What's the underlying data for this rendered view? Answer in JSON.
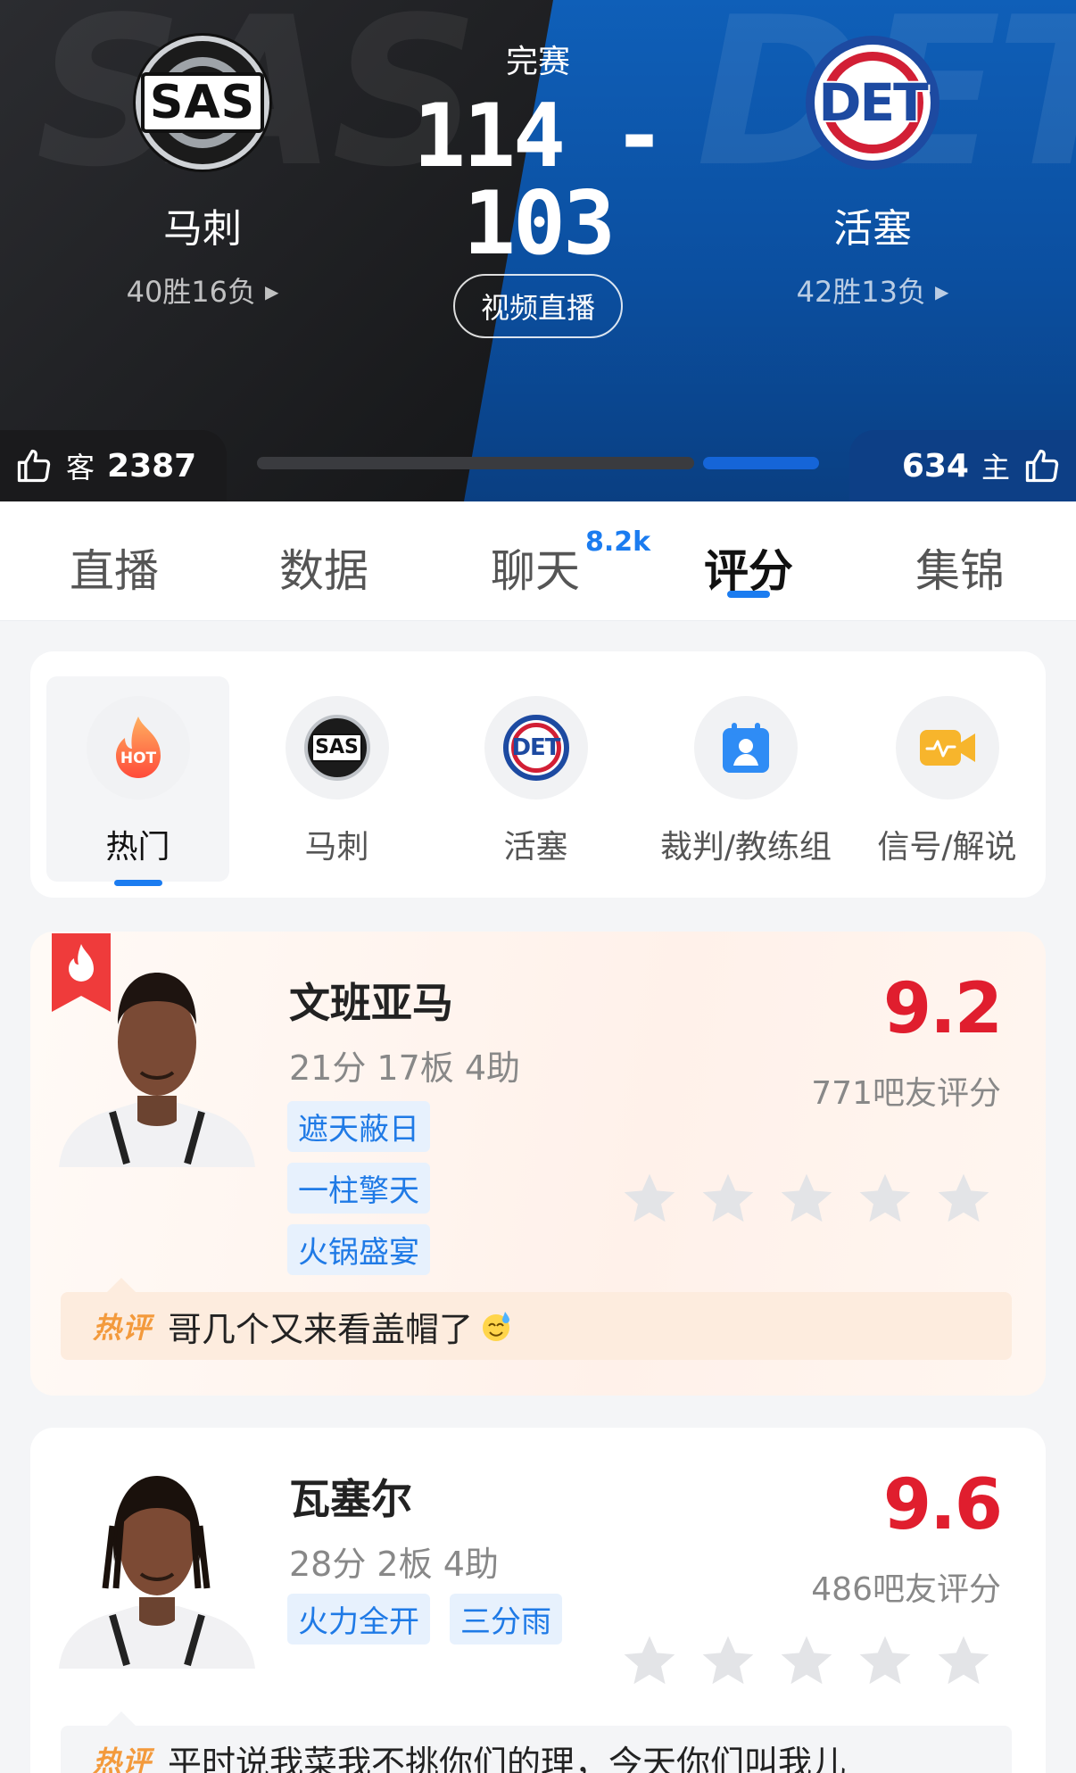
{
  "game": {
    "status": "完赛",
    "score": "114 - 103",
    "video_button": "视频直播"
  },
  "away_team": {
    "abbr": "SAS",
    "name": "马刺",
    "record": "40胜16负",
    "likes_label": "客",
    "likes": "2387",
    "color": "#1a1a1c"
  },
  "home_team": {
    "abbr": "DET",
    "name": "活塞",
    "record": "42胜13负",
    "likes_label": "主",
    "likes": "634",
    "color": "#0d3f86"
  },
  "like_ratio": {
    "away": 0.79,
    "home": 0.21
  },
  "tabs": [
    {
      "label": "直播"
    },
    {
      "label": "数据"
    },
    {
      "label": "聊天",
      "badge": "8.2k"
    },
    {
      "label": "评分",
      "active": true
    },
    {
      "label": "集锦"
    }
  ],
  "categories": [
    {
      "label": "热门",
      "icon": "hot-icon",
      "icon_text": "HOT",
      "active": true
    },
    {
      "label": "马刺",
      "icon": "spurs-logo-icon",
      "icon_text": "SAS"
    },
    {
      "label": "活塞",
      "icon": "pistons-logo-icon",
      "icon_text": "DET"
    },
    {
      "label": "裁判/教练组",
      "icon": "referee-icon"
    },
    {
      "label": "信号/解说",
      "icon": "camera-icon"
    }
  ],
  "players": [
    {
      "name": "文班亚马",
      "stats": "21分 17板 4助",
      "tags": [
        "遮天蔽日",
        "一柱擎天",
        "火锅盛宴"
      ],
      "rating": "9.2",
      "rating_count": "771吧友评分",
      "stars_filled": 0,
      "hot_comment_label": "热评",
      "hot_comment": "哥几个又来看盖帽了",
      "hot": true
    },
    {
      "name": "瓦塞尔",
      "stats": "28分 2板 4助",
      "tags": [
        "火力全开",
        "三分雨"
      ],
      "rating": "9.6",
      "rating_count": "486吧友评分",
      "stars_filled": 0,
      "hot_comment_label": "热评",
      "hot_comment": "平时说我菜我不挑你们的理，今天你们叫我儿"
    }
  ],
  "colors": {
    "accent": "#1b7cf0",
    "rating": "#e01e2e",
    "tag_bg": "#e7f1fd"
  }
}
